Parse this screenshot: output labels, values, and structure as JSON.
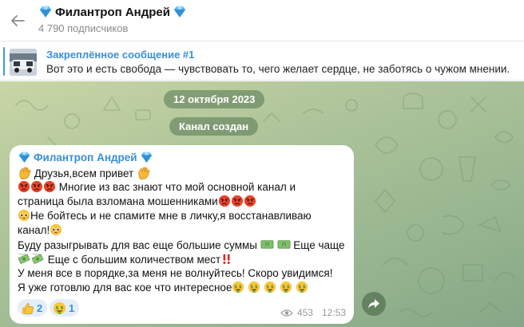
{
  "header": {
    "title": "Филантроп Андрей",
    "subscribers": "4 790 подписчиков"
  },
  "pinned": {
    "title": "Закреплённое сообщение #1",
    "text": "Вот это и есть свобода — чувствовать то, чего желает сердце, не заботясь о чужом мнении."
  },
  "service": {
    "date": "12 октября 2023",
    "created": "Канал создан"
  },
  "message": {
    "author": "Филантроп Андрей",
    "lines": [
      "Друзья,всем привет",
      "Многие из вас знают что мой основной канал и",
      "страница была взломана мошенниками",
      "Не бойтесь и не спамите мне в личку,я восстанавливаю",
      "канал!",
      "Буду разыгрывать для вас еще большие суммы",
      "Еще чаще",
      "Еще с большим количеством мест",
      "У меня все в порядке,за меня не волнуйтесь! Скоро увидимся!",
      "Я уже готовлю для вас кое что интересное"
    ],
    "reactions": [
      {
        "emoji": "thumbs-up",
        "count": "2"
      },
      {
        "emoji": "money-mouth-face",
        "count": "1"
      }
    ],
    "views": "453",
    "time": "12:53"
  },
  "colors": {
    "accent": "#3a8fd6",
    "chat_bg": "#aec49a",
    "angry": "#e8442a"
  },
  "icons": [
    "back-arrow-icon",
    "diamond-icon",
    "eye-icon",
    "share-icon",
    "waving-hand-icon",
    "angry-face-icon",
    "pleading-face-icon",
    "money-icon",
    "double-exclamation-icon",
    "money-mouth-face-icon"
  ]
}
